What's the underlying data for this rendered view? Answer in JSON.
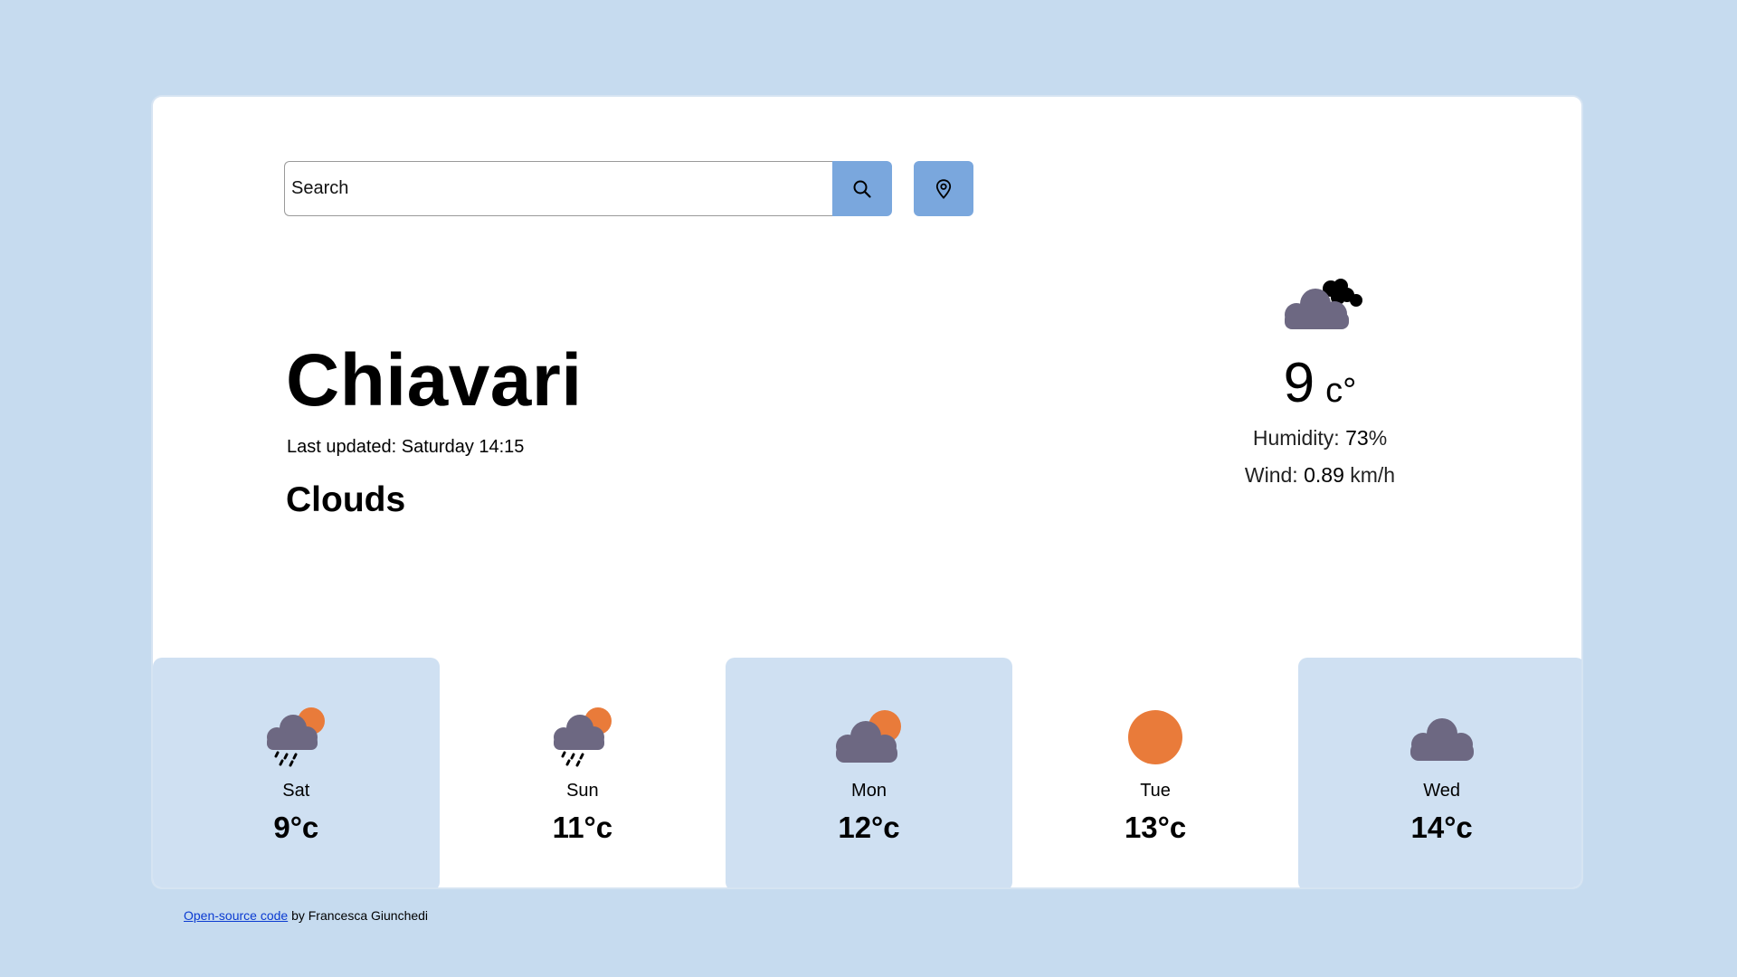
{
  "search": {
    "placeholder": "Search",
    "search_button_icon": "search-icon",
    "location_button_icon": "location-pin-icon"
  },
  "city": {
    "name": "Chiavari",
    "last_updated": "Last updated: Saturday 14:15",
    "condition": "Clouds"
  },
  "current": {
    "icon": "cloud-icon",
    "temperature": "9",
    "unit": "c°",
    "humidity_label": "Humidity:",
    "humidity_value": "73",
    "humidity_suffix": "%",
    "wind_label": "Wind:",
    "wind_value": "0.89",
    "wind_suffix": "km/h"
  },
  "forecast": [
    {
      "day": "Sat",
      "temp": "9°c",
      "icon": "rain-sun-icon"
    },
    {
      "day": "Sun",
      "temp": "11°c",
      "icon": "rain-sun-icon"
    },
    {
      "day": "Mon",
      "temp": "12°c",
      "icon": "cloud-sun-icon"
    },
    {
      "day": "Tue",
      "temp": "13°c",
      "icon": "sun-icon"
    },
    {
      "day": "Wed",
      "temp": "14°c",
      "icon": "cloud-icon"
    }
  ],
  "footer": {
    "link_text": "Open-source code",
    "suffix": " by Francesca Giunchedi"
  },
  "colors": {
    "page_background": "#c6dbef",
    "card_background": "#ffffff",
    "accent_button": "#7aa7dd",
    "forecast_shade": "#cfe0f2",
    "cloud": "#6d6882",
    "sun": "#e97b3a"
  }
}
